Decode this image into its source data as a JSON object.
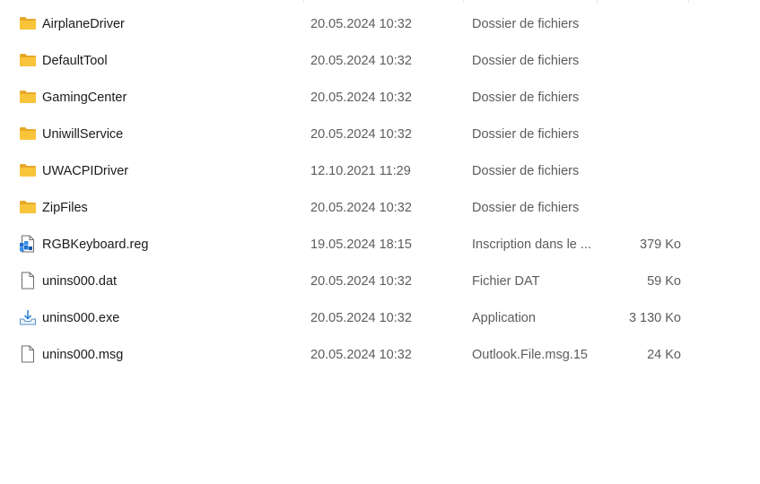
{
  "files": [
    {
      "name": "AirplaneDriver",
      "date": "20.05.2024 10:32",
      "type": "Dossier de fichiers",
      "size": "",
      "icon": "folder-icon"
    },
    {
      "name": "DefaultTool",
      "date": "20.05.2024 10:32",
      "type": "Dossier de fichiers",
      "size": "",
      "icon": "folder-icon"
    },
    {
      "name": "GamingCenter",
      "date": "20.05.2024 10:32",
      "type": "Dossier de fichiers",
      "size": "",
      "icon": "folder-icon"
    },
    {
      "name": "UniwillService",
      "date": "20.05.2024 10:32",
      "type": "Dossier de fichiers",
      "size": "",
      "icon": "folder-icon"
    },
    {
      "name": "UWACPIDriver",
      "date": "12.10.2021 11:29",
      "type": "Dossier de fichiers",
      "size": "",
      "icon": "folder-icon"
    },
    {
      "name": "ZipFiles",
      "date": "20.05.2024 10:32",
      "type": "Dossier de fichiers",
      "size": "",
      "icon": "folder-icon"
    },
    {
      "name": "RGBKeyboard.reg",
      "date": "19.05.2024 18:15",
      "type": "Inscription dans le ...",
      "size": "379 Ko",
      "icon": "registry-file-icon"
    },
    {
      "name": "unins000.dat",
      "date": "20.05.2024 10:32",
      "type": "Fichier DAT",
      "size": "59 Ko",
      "icon": "blank-file-icon"
    },
    {
      "name": "unins000.exe",
      "date": "20.05.2024 10:32",
      "type": "Application",
      "size": "3 130 Ko",
      "icon": "installer-exe-icon"
    },
    {
      "name": "unins000.msg",
      "date": "20.05.2024 10:32",
      "type": "Outlook.File.msg.15",
      "size": "24 Ko",
      "icon": "blank-file-icon"
    }
  ],
  "colors": {
    "folder": "#f8c43a",
    "folder_dark": "#e7a92a",
    "text_primary": "#1b1b1b",
    "text_secondary": "#5c5c5c",
    "registry_blue": "#1f6fd1"
  }
}
